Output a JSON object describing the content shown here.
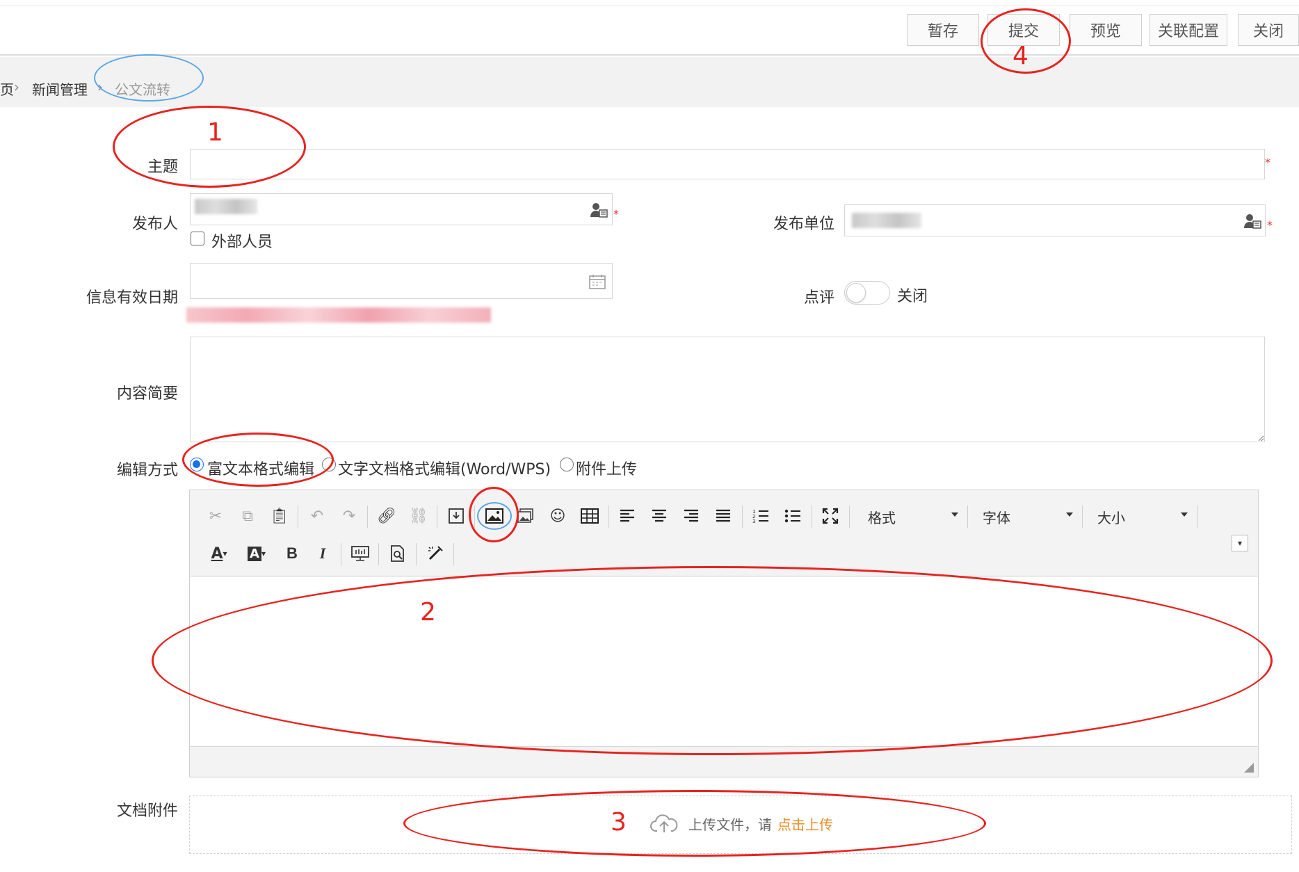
{
  "toolbar": {
    "save_draft": "暂存",
    "submit": "提交",
    "preview": "预览",
    "link_config": "关联配置",
    "close": "关闭"
  },
  "breadcrumb": {
    "home_partial": "页",
    "section": "新闻管理",
    "current": "公文流转"
  },
  "form": {
    "subject_label": "主题",
    "subject_value": "",
    "publisher_label": "发布人",
    "external_label": "外部人员",
    "publish_unit_label": "发布单位",
    "valid_date_label": "信息有效日期",
    "comment_label": "点评",
    "comment_state": "关闭",
    "summary_label": "内容简要",
    "summary_value": "",
    "edit_mode_label": "编辑方式",
    "edit_modes": [
      "富文本格式编辑",
      "文字文档格式编辑(Word/WPS)",
      "附件上传"
    ],
    "attachment_label": "文档附件",
    "upload_text": "上传文件，请",
    "upload_link": "点击上传"
  },
  "editor": {
    "format_label": "格式",
    "font_label": "字体",
    "size_label": "大小",
    "content": ""
  },
  "annotations": [
    "1",
    "2",
    "3",
    "4"
  ],
  "colors": {
    "annotation_red": "#e8231e",
    "annotation_blue": "#5aa7e6",
    "required": "#e53935",
    "upload_link": "#f08a24",
    "radio_selected": "#1a73e8"
  }
}
